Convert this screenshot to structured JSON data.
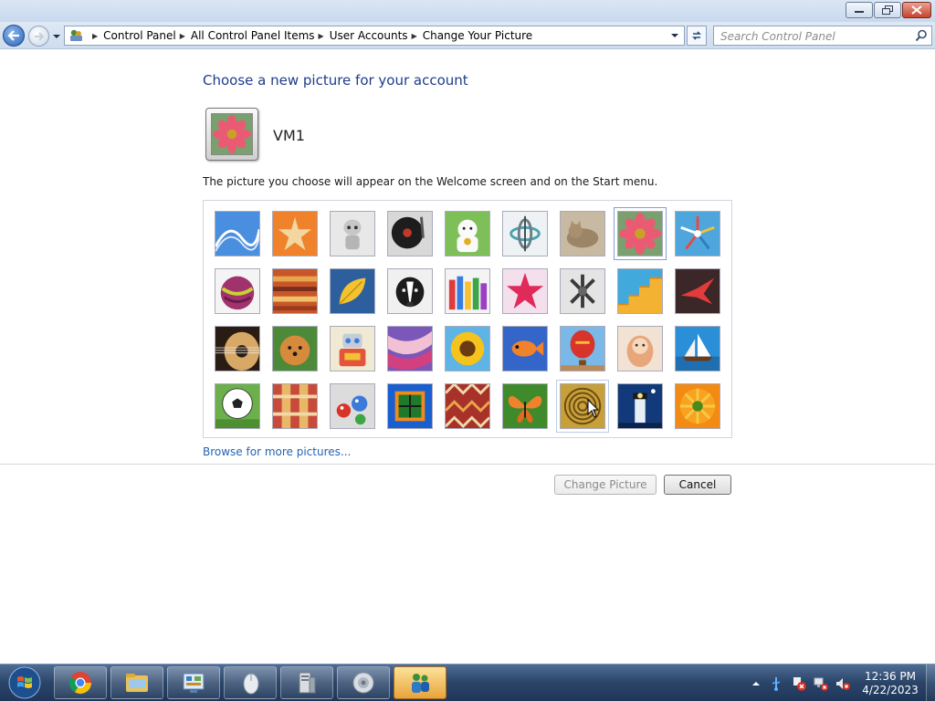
{
  "window": {
    "controls": {
      "minimize": "minimize-icon",
      "maximize": "restore-icon",
      "close": "close-icon"
    }
  },
  "nav": {
    "breadcrumbs": [
      "Control Panel",
      "All Control Panel Items",
      "User Accounts",
      "Change Your Picture"
    ],
    "search_placeholder": "Search Control Panel"
  },
  "main": {
    "heading": "Choose a new picture for your account",
    "username": "VM1",
    "hint": "The picture you choose will appear on the Welcome screen and on the Start menu.",
    "browse_link": "Browse for more pictures...",
    "change_button": "Change Picture",
    "cancel_button": "Cancel",
    "selected_picture": "flower",
    "pictures": [
      "roller-coaster",
      "starfish",
      "robot-toy",
      "turntable",
      "lucky-cat",
      "gyroscope",
      "kitten",
      "flower",
      "pinwheel",
      "ball",
      "fabric",
      "leaf",
      "dog",
      "crayons",
      "paper-star",
      "jacks",
      "stairs",
      "origami-crane",
      "guitar",
      "puppy",
      "robot",
      "scarf",
      "sunflower",
      "fish",
      "hot-air-balloon",
      "doll",
      "sailboat",
      "soccer-ball",
      "textile",
      "marbles",
      "window",
      "rug",
      "butterfly",
      "spiral",
      "lighthouse",
      "gerbera"
    ]
  },
  "taskbar": {
    "items": [
      "chrome-icon",
      "explorer-icon",
      "control-panel-icon",
      "mouse-icon",
      "server-icon",
      "speaker-icon",
      "user-accounts-icon"
    ],
    "clock_time": "12:36 PM",
    "clock_date": "4/22/2023"
  }
}
